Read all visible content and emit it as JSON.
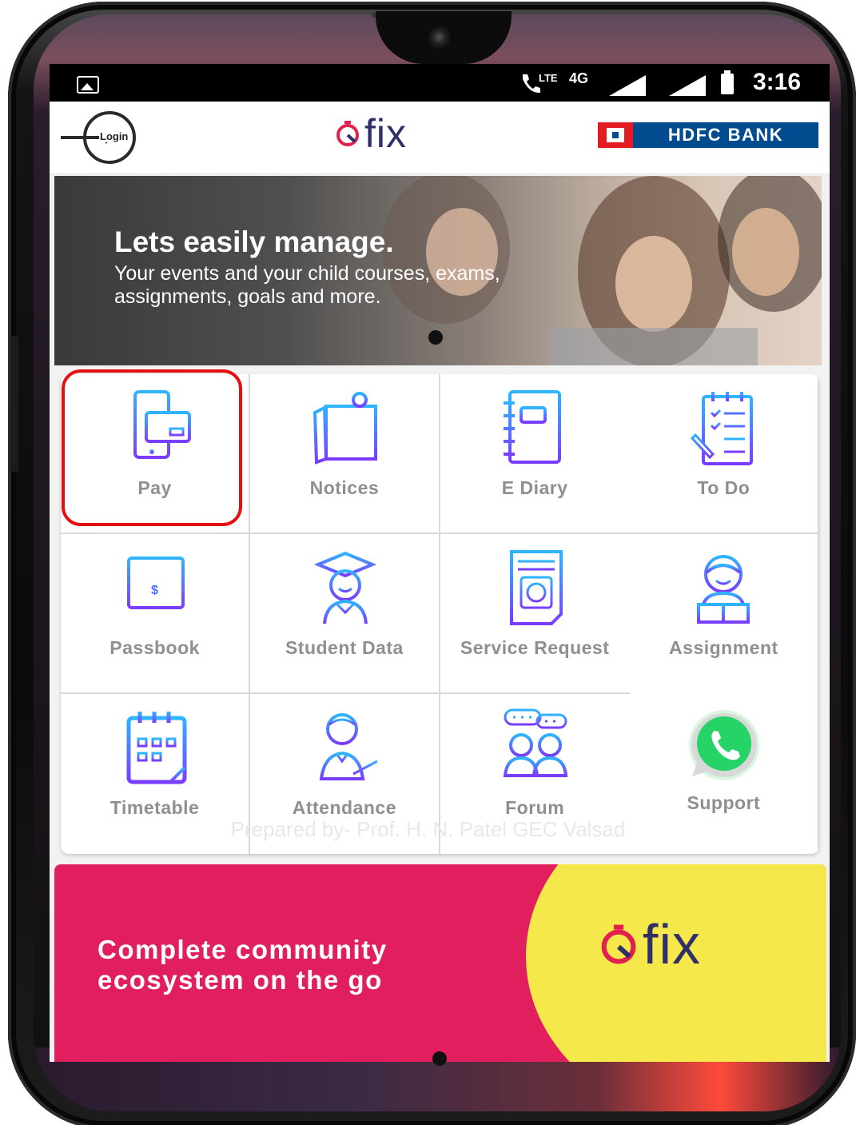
{
  "status_bar": {
    "network_label": "LTE",
    "data_label": "4G",
    "time": "3:16",
    "icons": [
      "gallery-icon",
      "wifi-calling-icon",
      "signal-icon",
      "signal-icon",
      "battery-icon"
    ]
  },
  "app_bar": {
    "login_label": "Login",
    "logo_text": "fix",
    "bank_name": "HDFC BANK"
  },
  "banner": {
    "title": "Lets easily manage.",
    "subtitle": "Your events and your child courses, exams, assignments, goals and more."
  },
  "menu": {
    "items": [
      {
        "label": "Pay",
        "icon": "pay-icon"
      },
      {
        "label": "Notices",
        "icon": "notices-icon"
      },
      {
        "label": "E Diary",
        "icon": "diary-icon"
      },
      {
        "label": "To Do",
        "icon": "todo-icon"
      },
      {
        "label": "Passbook",
        "icon": "passbook-icon"
      },
      {
        "label": "Student Data",
        "icon": "student-icon"
      },
      {
        "label": "Service Request",
        "icon": "service-request-icon"
      },
      {
        "label": "Assignment",
        "icon": "assignment-icon"
      },
      {
        "label": "Timetable",
        "icon": "calendar-icon"
      },
      {
        "label": "Attendance",
        "icon": "attendance-icon"
      },
      {
        "label": "Forum",
        "icon": "forum-icon"
      },
      {
        "label": "Support",
        "icon": "whatsapp-icon"
      }
    ],
    "highlighted_item": "Pay"
  },
  "promo": {
    "text": "Complete community ecosystem on the go",
    "logo_text": "fix"
  },
  "caption": "Prepared by- Prof. H. N. Patel GEC Valsad",
  "colors": {
    "icon_gradient_start": "#2fb4ff",
    "icon_gradient_end": "#7a3cff",
    "promo_pink": "#e21f5e",
    "promo_yellow": "#f5e84a",
    "hdfc_blue": "#004c8f",
    "hdfc_red": "#e31b23",
    "highlight_red": "#e31010"
  }
}
